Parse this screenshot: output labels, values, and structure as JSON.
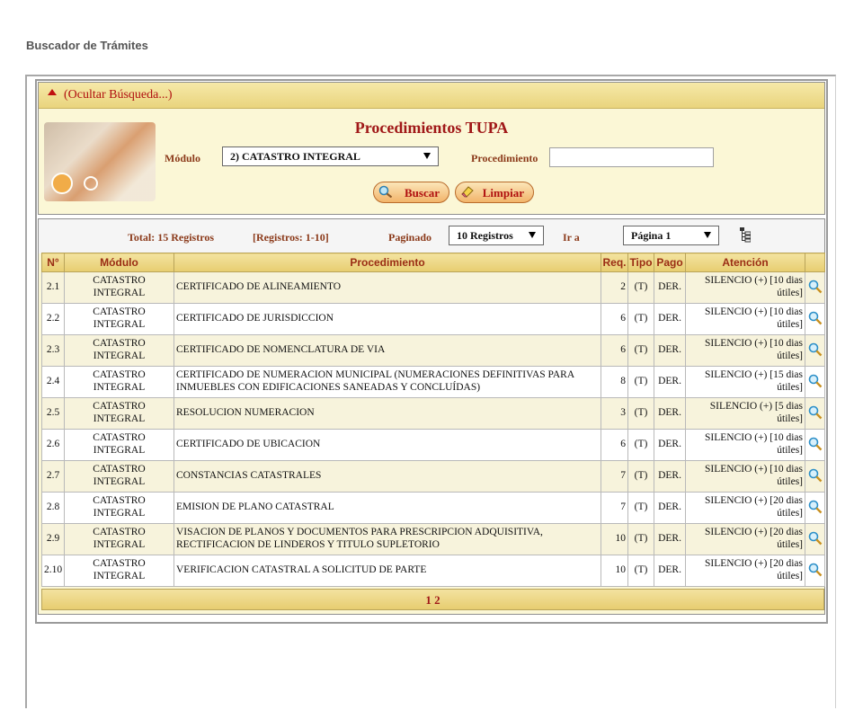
{
  "page": {
    "heading": "Buscador de Trámites"
  },
  "search": {
    "toggle_label": "(Ocultar Búsqueda...)",
    "title": "Procedimientos TUPA",
    "modulo_label": "Módulo",
    "modulo_value": "2) CATASTRO INTEGRAL",
    "procedimiento_label": "Procedimiento",
    "procedimiento_value": "",
    "buscar_label": "Buscar",
    "limpiar_label": "Limpiar"
  },
  "results_info": {
    "total": "Total: 15 Registros",
    "range": "[Registros: 1-10]",
    "paginado_label": "Paginado",
    "paginado_value": "10 Registros",
    "ir_label": "Ir a",
    "pagina_value": "Página 1"
  },
  "table": {
    "headers": [
      "N°",
      "Módulo",
      "Procedimiento",
      "Req.",
      "Tipo",
      "Pago",
      "Atención"
    ],
    "rows": [
      {
        "n": "2.1",
        "modulo": "CATASTRO INTEGRAL",
        "proc": "CERTIFICADO DE ALINEAMIENTO",
        "req": "2",
        "tipo": "(T)",
        "pago": "DER.",
        "atencion": "SILENCIO (+) [10 dias útiles]"
      },
      {
        "n": "2.2",
        "modulo": "CATASTRO INTEGRAL",
        "proc": "CERTIFICADO DE JURISDICCION",
        "req": "6",
        "tipo": "(T)",
        "pago": "DER.",
        "atencion": "SILENCIO (+) [10 dias útiles]"
      },
      {
        "n": "2.3",
        "modulo": "CATASTRO INTEGRAL",
        "proc": "CERTIFICADO DE NOMENCLATURA DE VIA",
        "req": "6",
        "tipo": "(T)",
        "pago": "DER.",
        "atencion": "SILENCIO (+) [10 dias útiles]"
      },
      {
        "n": "2.4",
        "modulo": "CATASTRO INTEGRAL",
        "proc": "CERTIFICADO DE NUMERACION MUNICIPAL (NUMERACIONES DEFINITIVAS PARA INMUEBLES CON EDIFICACIONES SANEADAS Y CONCLUÍDAS)",
        "req": "8",
        "tipo": "(T)",
        "pago": "DER.",
        "atencion": "SILENCIO (+) [15 dias útiles]"
      },
      {
        "n": "2.5",
        "modulo": "CATASTRO INTEGRAL",
        "proc": "RESOLUCION NUMERACION",
        "req": "3",
        "tipo": "(T)",
        "pago": "DER.",
        "atencion": "SILENCIO (+) [5 dias útiles]"
      },
      {
        "n": "2.6",
        "modulo": "CATASTRO INTEGRAL",
        "proc": "CERTIFICADO DE UBICACION",
        "req": "6",
        "tipo": "(T)",
        "pago": "DER.",
        "atencion": "SILENCIO (+) [10 dias útiles]"
      },
      {
        "n": "2.7",
        "modulo": "CATASTRO INTEGRAL",
        "proc": "CONSTANCIAS CATASTRALES",
        "req": "7",
        "tipo": "(T)",
        "pago": "DER.",
        "atencion": "SILENCIO (+) [10 dias útiles]"
      },
      {
        "n": "2.8",
        "modulo": "CATASTRO INTEGRAL",
        "proc": "EMISION DE PLANO CATASTRAL",
        "req": "7",
        "tipo": "(T)",
        "pago": "DER.",
        "atencion": "SILENCIO (+) [20 dias útiles]"
      },
      {
        "n": "2.9",
        "modulo": "CATASTRO INTEGRAL",
        "proc": "VISACION DE PLANOS Y DOCUMENTOS PARA PRESCRIPCION ADQUISITIVA, RECTIFICACION DE LINDEROS Y TITULO SUPLETORIO",
        "req": "10",
        "tipo": "(T)",
        "pago": "DER.",
        "atencion": "SILENCIO (+) [20 dias útiles]"
      },
      {
        "n": "2.10",
        "modulo": "CATASTRO INTEGRAL",
        "proc": "VERIFICACION CATASTRAL A SOLICITUD DE PARTE",
        "req": "10",
        "tipo": "(T)",
        "pago": "DER.",
        "atencion": "SILENCIO (+) [20 dias útiles]"
      }
    ]
  },
  "pager": {
    "page1": "1",
    "page2": "2"
  },
  "colors": {
    "header_gold": "#e7cd70",
    "title_red": "#a01818",
    "label_brown": "#8b3a1a",
    "panel_cream": "#fbf7d6"
  }
}
